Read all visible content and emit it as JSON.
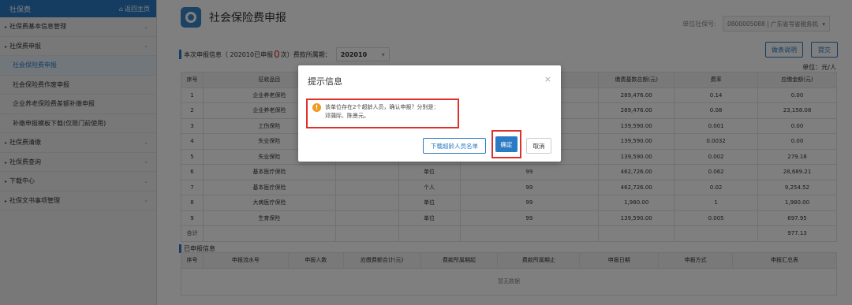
{
  "sidebar": {
    "header": "社保费",
    "home_link": "返回主页",
    "items": [
      {
        "label": "社保费基本信息管理",
        "type": "group"
      },
      {
        "label": "社保费申报",
        "type": "group"
      },
      {
        "label": "社会保险费申报",
        "type": "sub",
        "active": true
      },
      {
        "label": "社会保险费作废申报",
        "type": "sub"
      },
      {
        "label": "企业养老保险费差额补缴申报",
        "type": "sub"
      },
      {
        "label": "补缴申报模板下载(仅限门前使用)",
        "type": "sub"
      },
      {
        "label": "社保费清缴",
        "type": "group"
      },
      {
        "label": "社保费查询",
        "type": "group"
      },
      {
        "label": "下载中心",
        "type": "group"
      },
      {
        "label": "社保文书事项管理",
        "type": "group"
      }
    ]
  },
  "header": {
    "title": "社会保险费申报",
    "unit_label": "单位社保号:",
    "unit_value": "0800005088 | 广东省号省税务机"
  },
  "info": {
    "label": "本次申报信息",
    "period_text_a": "（ 202010已申报 ",
    "count": "0",
    "period_text_b": "次）费款所属期：",
    "period_value": "202010"
  },
  "buttons": {
    "help": "做表说明",
    "submit": "提交"
  },
  "unit_hint": "单位：元/人",
  "table1": {
    "headers": [
      "序号",
      "征收品目",
      "",
      "",
      "",
      "缴费基数总额(元)",
      "费率",
      "应缴金额(元)"
    ],
    "rows": [
      [
        "1",
        "企业养老保险",
        "",
        "",
        "",
        "289,476.00",
        "0.14",
        "0.00"
      ],
      [
        "2",
        "企业养老保险",
        "",
        "",
        "",
        "289,476.00",
        "0.08",
        "23,158.08"
      ],
      [
        "3",
        "工伤保险",
        "",
        "",
        "",
        "139,590.00",
        "0.001",
        "0.00"
      ],
      [
        "4",
        "失业保险",
        "",
        "",
        "",
        "139,590.00",
        "0.0032",
        "0.00"
      ],
      [
        "5",
        "失业保险",
        "",
        "",
        "",
        "139,590.00",
        "0.002",
        "279.18"
      ],
      [
        "6",
        "基本医疗保险",
        "",
        "单位",
        "99",
        "462,726.00",
        "0.062",
        "28,689.21"
      ],
      [
        "7",
        "基本医疗保险",
        "",
        "个人",
        "99",
        "462,726.00",
        "0.02",
        "9,254.52"
      ],
      [
        "8",
        "大病医疗保险",
        "",
        "单位",
        "99",
        "1,980.00",
        "1",
        "1,980.00"
      ],
      [
        "9",
        "生育保险",
        "",
        "单位",
        "99",
        "139,590.00",
        "0.005",
        "697.95"
      ]
    ],
    "total_label": "合计",
    "total_value": "977.13"
  },
  "section2": {
    "label": "已申报信息",
    "headers": [
      "序号",
      "申报流水号",
      "申报人数",
      "应缴费额合计(元)",
      "费款所属期起",
      "费款所属期止",
      "申报日期",
      "申报方式",
      "申报汇总表"
    ],
    "empty": "暂无数据"
  },
  "modal": {
    "title": "提示信息",
    "close": "×",
    "icon": "!",
    "message_line1": "该单位存在2个超龄人员，确认申报？分别是：",
    "message_line2": "邓蒲际、陈景元。",
    "download_btn": "下载超龄人员名单",
    "confirm_btn": "确定",
    "cancel_btn": "取消"
  }
}
